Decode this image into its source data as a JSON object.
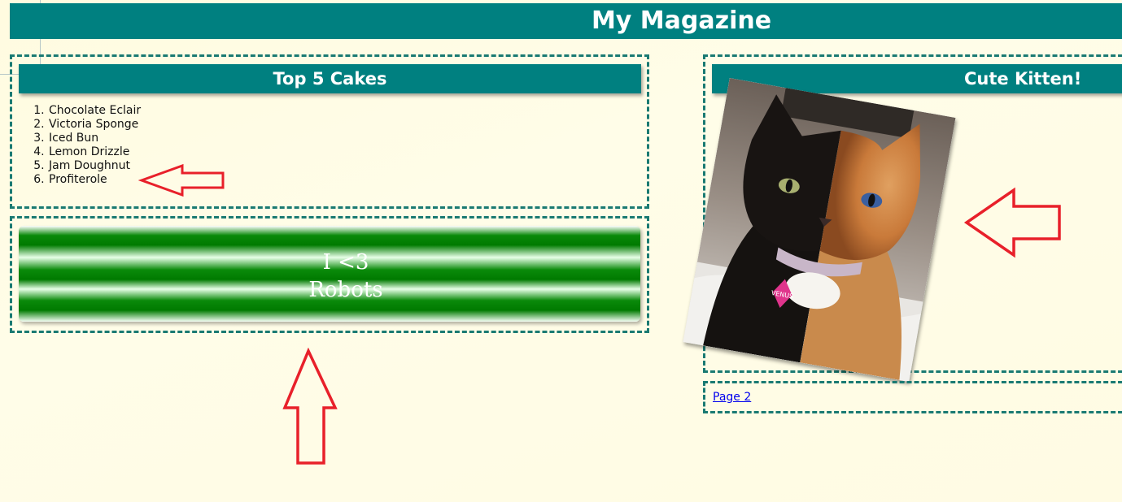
{
  "masthead": {
    "title": "My Magazine"
  },
  "cakes_panel": {
    "title": "Top 5 Cakes",
    "items": [
      "Chocolate Eclair",
      "Victoria Sponge",
      "Iced Bun",
      "Lemon Drizzle",
      "Jam Doughnut",
      "Profiterole"
    ]
  },
  "robot_banner": {
    "line1": "I <3",
    "line2": "Robots"
  },
  "kitten_panel": {
    "title": "Cute Kitten!",
    "tag_text": "VENUS"
  },
  "footer_panel": {
    "link_text": "Page 2"
  },
  "colors": {
    "teal": "#008080",
    "dashed_border": "#1a7a72",
    "annotation_red": "#e8202a",
    "banner_green": "#007a00",
    "link": "#0000ee"
  },
  "annotations": [
    {
      "icon": "arrow-left-icon",
      "points_to": "cake-list"
    },
    {
      "icon": "arrow-left-icon",
      "points_to": "kitten-photo"
    },
    {
      "icon": "arrow-up-icon",
      "points_to": "robot-banner"
    }
  ]
}
